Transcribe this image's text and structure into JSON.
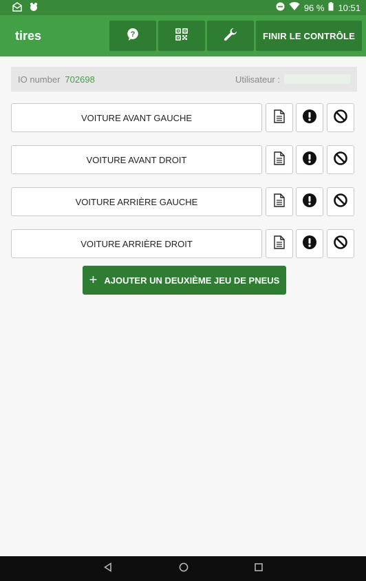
{
  "status_bar": {
    "battery": "96 %",
    "time": "10:51"
  },
  "app_bar": {
    "title": "tires",
    "finish_button": "FINIR LE CONTRÔLE",
    "icons": [
      "help-icon",
      "qr-code-icon",
      "wrench-icon"
    ]
  },
  "info": {
    "io_label": "IO number",
    "io_value": "702698",
    "user_label": "Utilisateur :"
  },
  "tires": [
    {
      "label": "VOITURE AVANT GAUCHE"
    },
    {
      "label": "VOITURE AVANT DROIT"
    },
    {
      "label": "VOITURE ARRIÈRE GAUCHE"
    },
    {
      "label": "VOITURE ARRIÈRE DROIT"
    }
  ],
  "add_button": {
    "label": "AJOUTER UN DEUXIÈME JEU DE PNEUS"
  },
  "colors": {
    "status_bar": "#388a3a",
    "app_bar": "#43a047",
    "accent_dark": "#2e7d32",
    "io_value": "#43a047"
  }
}
